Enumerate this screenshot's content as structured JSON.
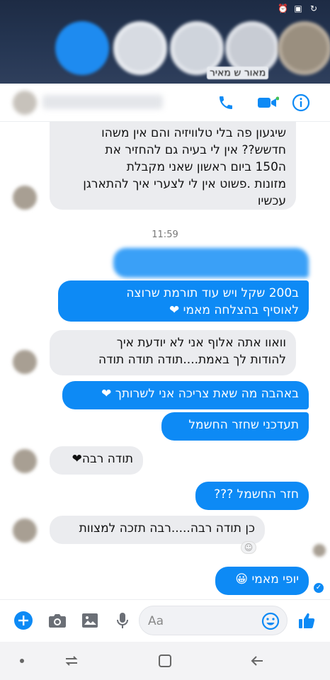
{
  "status_bar": {
    "icons": [
      "alarm-icon",
      "gallery-icon",
      "sync-icon"
    ]
  },
  "chat_heads": {
    "caption": "מאור ש מאיר"
  },
  "header": {
    "icons": [
      "phone-icon",
      "video-call-icon",
      "info-icon"
    ],
    "accent": "#0d8af5"
  },
  "messages": {
    "m1": "שיגעון פה בלי טלוויזיה והם אין משהו\nחדשש?? אין לי בעיה גם להחזיר את\nה150 ביום ראשון שאני מקבלת\nמזונות .פשוט אין לי לצערי איך להתארגן\nעכשיו",
    "time": "11:59",
    "m2": "ב200 שקל ויש עוד תורמת שרוצה\nלאוסיף בהצלחה מאמי ❤",
    "m3": "וואוו אתה אלוף אני לא יודעת איך\nלהודות לך באמת....תודה תודה תודה",
    "m4": "באהבה מה שאת צריכה אני לשרותך ❤",
    "m5": "תעדכני שחזר החשמל",
    "m6": "תודה רבה❤",
    "m7": "חזר החשמל ???",
    "m8": "כן תודה רבה.....רבה תזכה למצוות",
    "m9": "יופי מאמי 😀"
  },
  "composer": {
    "placeholder": "Aa",
    "icons": [
      "plus-icon",
      "camera-icon",
      "image-icon",
      "microphone-icon",
      "emoji-icon",
      "like-icon"
    ]
  },
  "system_nav": {
    "icons": [
      "dot-icon",
      "recents-icon",
      "home-icon",
      "back-icon"
    ]
  },
  "colors": {
    "outgoing": "#0d8af5",
    "incoming": "#ebecef",
    "messenger_blue": "#0d8af5"
  }
}
